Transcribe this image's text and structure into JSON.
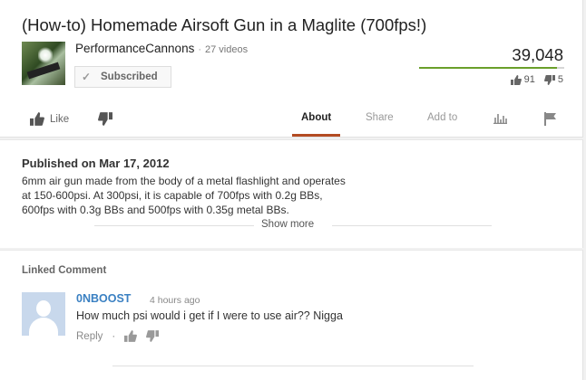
{
  "video": {
    "title": "(How-to) Homemade Airsoft Gun in a Maglite (700fps!)",
    "channel": "PerformanceCannons",
    "video_count": "27 videos",
    "subscribe_label": "Subscribed",
    "views": "39,048",
    "likes": "91",
    "dislikes": "5",
    "like_ratio": 0.95
  },
  "actions": {
    "like_label": "Like",
    "tabs": [
      "About",
      "Share",
      "Add to"
    ]
  },
  "description": {
    "published": "Published on Mar 17, 2012",
    "lines": [
      "6mm air gun made from the body of a metal flashlight and operates",
      "at 150-600psi. At 300psi, it is capable of 700fps with 0.2g BBs,",
      "600fps with 0.3g BBs and 500fps with 0.35g metal BBs."
    ],
    "show_more": "Show more"
  },
  "comments": {
    "section_label": "Linked Comment",
    "author": "0NBOOST",
    "time": "4 hours ago",
    "text": "How much psi would i get if I were to use air?? Nigga",
    "reply_label": "Reply"
  },
  "colors": {
    "accent_green": "#6a9f2a",
    "tab_underline": "#b34b22",
    "author_link": "#3a80c2"
  }
}
